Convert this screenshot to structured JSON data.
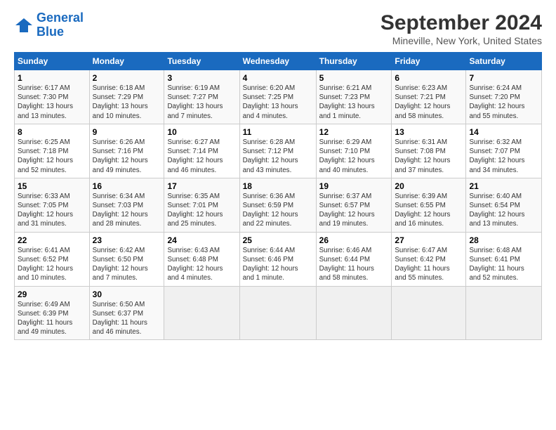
{
  "logo": {
    "line1": "General",
    "line2": "Blue"
  },
  "title": "September 2024",
  "subtitle": "Mineville, New York, United States",
  "days_of_week": [
    "Sunday",
    "Monday",
    "Tuesday",
    "Wednesday",
    "Thursday",
    "Friday",
    "Saturday"
  ],
  "weeks": [
    [
      {
        "day": "1",
        "info": "Sunrise: 6:17 AM\nSunset: 7:30 PM\nDaylight: 13 hours\nand 13 minutes."
      },
      {
        "day": "2",
        "info": "Sunrise: 6:18 AM\nSunset: 7:29 PM\nDaylight: 13 hours\nand 10 minutes."
      },
      {
        "day": "3",
        "info": "Sunrise: 6:19 AM\nSunset: 7:27 PM\nDaylight: 13 hours\nand 7 minutes."
      },
      {
        "day": "4",
        "info": "Sunrise: 6:20 AM\nSunset: 7:25 PM\nDaylight: 13 hours\nand 4 minutes."
      },
      {
        "day": "5",
        "info": "Sunrise: 6:21 AM\nSunset: 7:23 PM\nDaylight: 13 hours\nand 1 minute."
      },
      {
        "day": "6",
        "info": "Sunrise: 6:23 AM\nSunset: 7:21 PM\nDaylight: 12 hours\nand 58 minutes."
      },
      {
        "day": "7",
        "info": "Sunrise: 6:24 AM\nSunset: 7:20 PM\nDaylight: 12 hours\nand 55 minutes."
      }
    ],
    [
      {
        "day": "8",
        "info": "Sunrise: 6:25 AM\nSunset: 7:18 PM\nDaylight: 12 hours\nand 52 minutes."
      },
      {
        "day": "9",
        "info": "Sunrise: 6:26 AM\nSunset: 7:16 PM\nDaylight: 12 hours\nand 49 minutes."
      },
      {
        "day": "10",
        "info": "Sunrise: 6:27 AM\nSunset: 7:14 PM\nDaylight: 12 hours\nand 46 minutes."
      },
      {
        "day": "11",
        "info": "Sunrise: 6:28 AM\nSunset: 7:12 PM\nDaylight: 12 hours\nand 43 minutes."
      },
      {
        "day": "12",
        "info": "Sunrise: 6:29 AM\nSunset: 7:10 PM\nDaylight: 12 hours\nand 40 minutes."
      },
      {
        "day": "13",
        "info": "Sunrise: 6:31 AM\nSunset: 7:08 PM\nDaylight: 12 hours\nand 37 minutes."
      },
      {
        "day": "14",
        "info": "Sunrise: 6:32 AM\nSunset: 7:07 PM\nDaylight: 12 hours\nand 34 minutes."
      }
    ],
    [
      {
        "day": "15",
        "info": "Sunrise: 6:33 AM\nSunset: 7:05 PM\nDaylight: 12 hours\nand 31 minutes."
      },
      {
        "day": "16",
        "info": "Sunrise: 6:34 AM\nSunset: 7:03 PM\nDaylight: 12 hours\nand 28 minutes."
      },
      {
        "day": "17",
        "info": "Sunrise: 6:35 AM\nSunset: 7:01 PM\nDaylight: 12 hours\nand 25 minutes."
      },
      {
        "day": "18",
        "info": "Sunrise: 6:36 AM\nSunset: 6:59 PM\nDaylight: 12 hours\nand 22 minutes."
      },
      {
        "day": "19",
        "info": "Sunrise: 6:37 AM\nSunset: 6:57 PM\nDaylight: 12 hours\nand 19 minutes."
      },
      {
        "day": "20",
        "info": "Sunrise: 6:39 AM\nSunset: 6:55 PM\nDaylight: 12 hours\nand 16 minutes."
      },
      {
        "day": "21",
        "info": "Sunrise: 6:40 AM\nSunset: 6:54 PM\nDaylight: 12 hours\nand 13 minutes."
      }
    ],
    [
      {
        "day": "22",
        "info": "Sunrise: 6:41 AM\nSunset: 6:52 PM\nDaylight: 12 hours\nand 10 minutes."
      },
      {
        "day": "23",
        "info": "Sunrise: 6:42 AM\nSunset: 6:50 PM\nDaylight: 12 hours\nand 7 minutes."
      },
      {
        "day": "24",
        "info": "Sunrise: 6:43 AM\nSunset: 6:48 PM\nDaylight: 12 hours\nand 4 minutes."
      },
      {
        "day": "25",
        "info": "Sunrise: 6:44 AM\nSunset: 6:46 PM\nDaylight: 12 hours\nand 1 minute."
      },
      {
        "day": "26",
        "info": "Sunrise: 6:46 AM\nSunset: 6:44 PM\nDaylight: 11 hours\nand 58 minutes."
      },
      {
        "day": "27",
        "info": "Sunrise: 6:47 AM\nSunset: 6:42 PM\nDaylight: 11 hours\nand 55 minutes."
      },
      {
        "day": "28",
        "info": "Sunrise: 6:48 AM\nSunset: 6:41 PM\nDaylight: 11 hours\nand 52 minutes."
      }
    ],
    [
      {
        "day": "29",
        "info": "Sunrise: 6:49 AM\nSunset: 6:39 PM\nDaylight: 11 hours\nand 49 minutes."
      },
      {
        "day": "30",
        "info": "Sunrise: 6:50 AM\nSunset: 6:37 PM\nDaylight: 11 hours\nand 46 minutes."
      },
      null,
      null,
      null,
      null,
      null
    ]
  ]
}
